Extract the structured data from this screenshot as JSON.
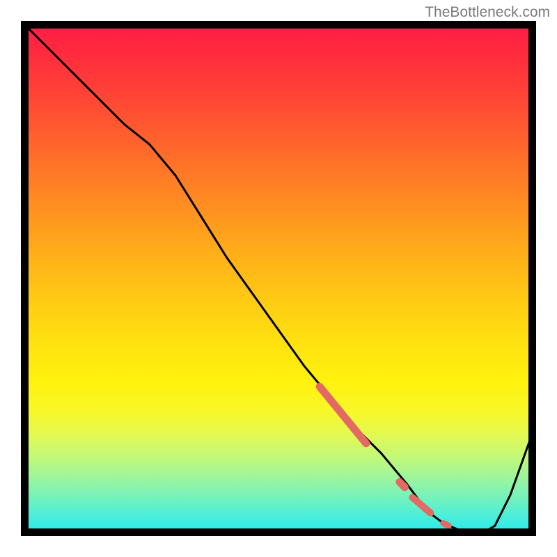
{
  "watermark": "TheBottleneck.com",
  "chart_data": {
    "type": "line",
    "title": "",
    "xlabel": "",
    "ylabel": "",
    "xlim": [
      0,
      100
    ],
    "ylim": [
      0,
      100
    ],
    "grid": false,
    "legend": false,
    "series": [
      {
        "name": "bottleneck-curve",
        "color": "#000000",
        "x": [
          0,
          5,
          10,
          15,
          20,
          25,
          30,
          35,
          40,
          45,
          50,
          55,
          60,
          65,
          70,
          75,
          78,
          80,
          82,
          85,
          88,
          90,
          92,
          95,
          100
        ],
        "y": [
          100,
          95,
          90,
          85,
          80,
          76,
          70,
          62,
          54,
          47,
          40,
          33,
          27,
          21,
          16,
          10,
          6,
          4,
          2.5,
          1.2,
          0.8,
          0.8,
          2,
          8,
          22
        ]
      }
    ],
    "highlight_segments": [
      {
        "name": "thick-salmon-main",
        "color": "#e26a62",
        "width": 11,
        "x": [
          58,
          67
        ],
        "y": [
          29,
          18
        ]
      },
      {
        "name": "salmon-dot-1",
        "color": "#e26a62",
        "width": 11,
        "x": [
          73.5,
          74.5
        ],
        "y": [
          10.5,
          9.5
        ]
      },
      {
        "name": "salmon-dash-2",
        "color": "#e26a62",
        "width": 10,
        "x": [
          76,
          79.5
        ],
        "y": [
          7.5,
          4.5
        ]
      },
      {
        "name": "salmon-dot-3",
        "color": "#e26a62",
        "width": 9,
        "x": [
          82,
          83
        ],
        "y": [
          2.5,
          2
        ]
      }
    ],
    "background_gradient": {
      "top": "#ff1a46",
      "mid": "#ffe010",
      "bottom": "#22e9f2"
    }
  }
}
